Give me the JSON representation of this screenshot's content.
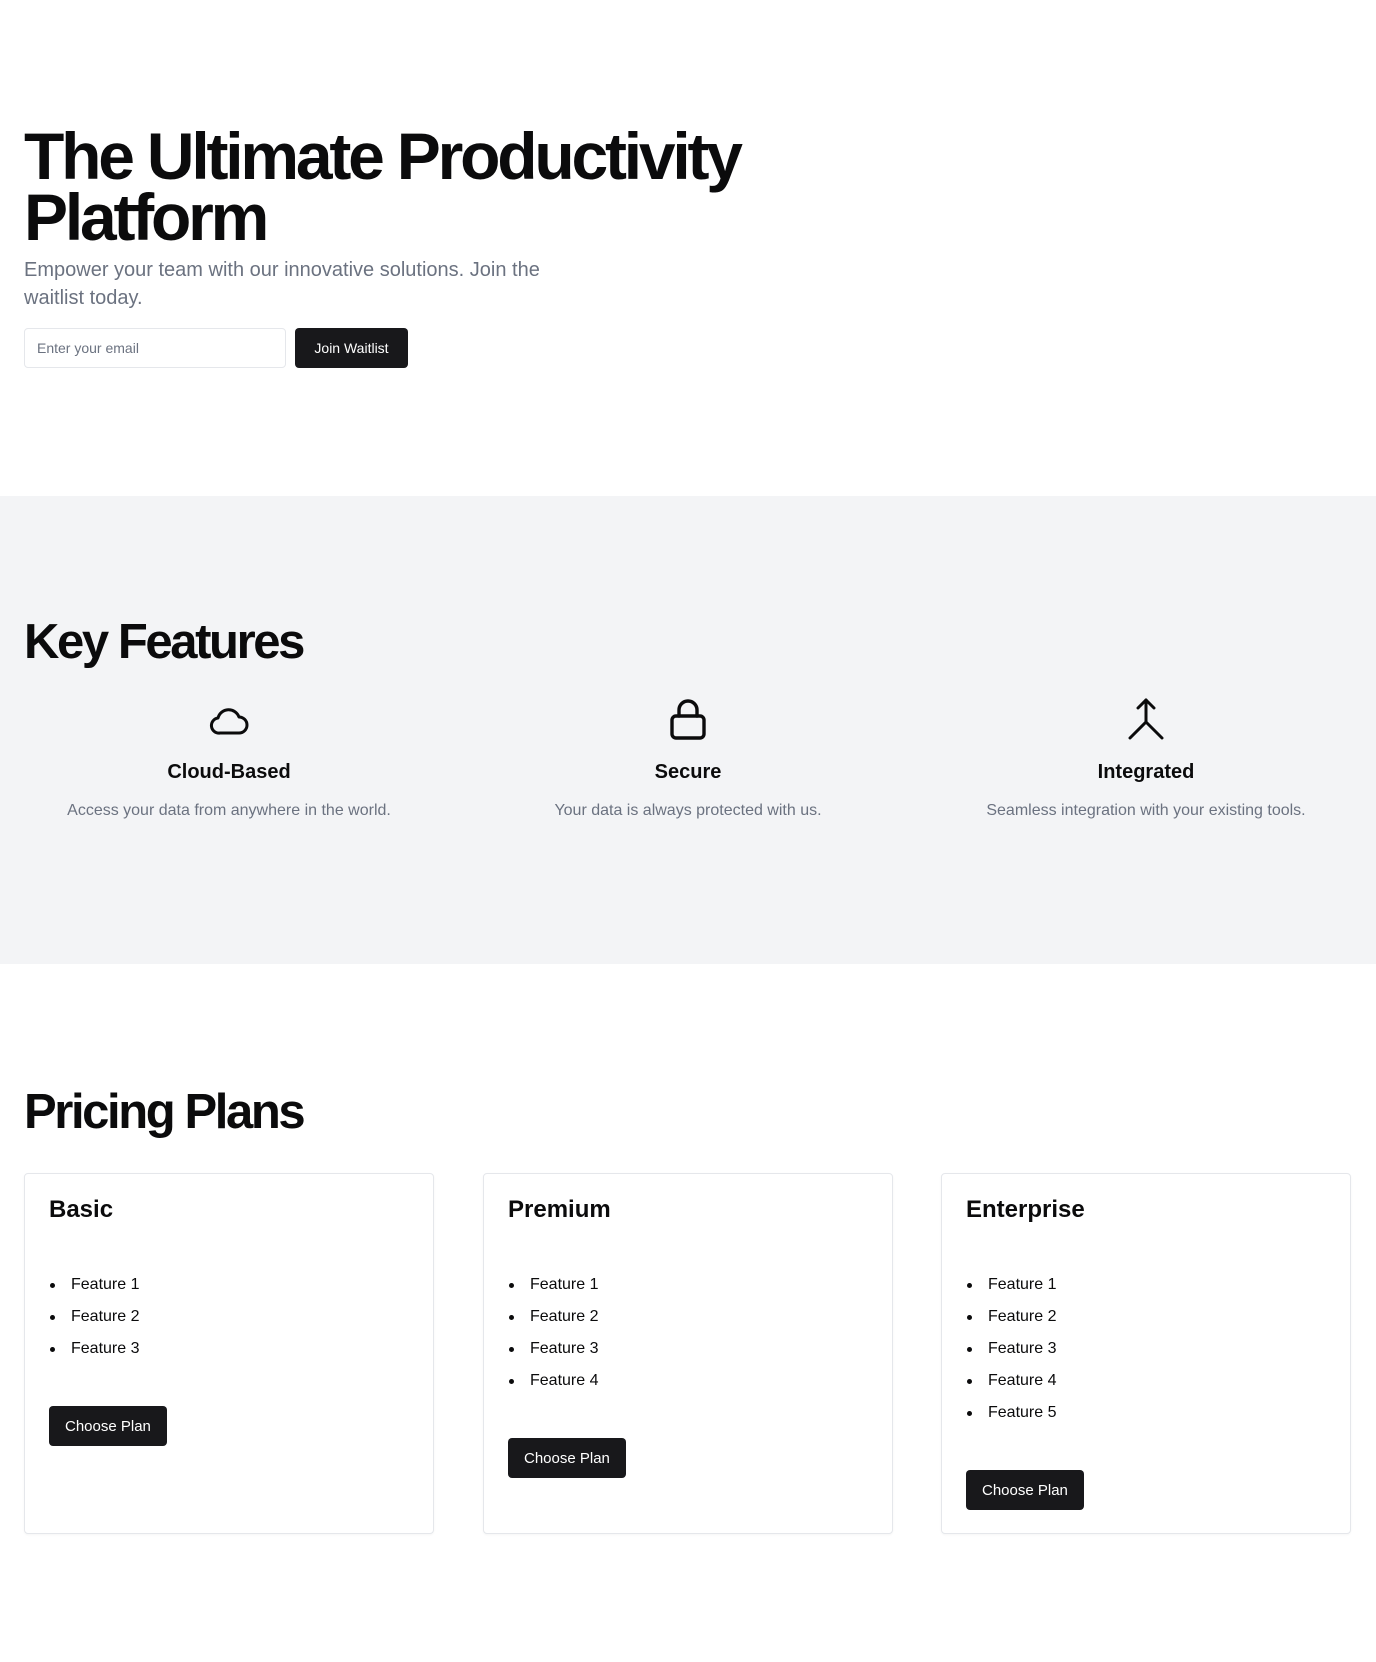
{
  "hero": {
    "title": "The Ultimate Productivity Platform",
    "subtitle": "Empower your team with our innovative solutions. Join the waitlist today.",
    "email_placeholder": "Enter your email",
    "email_value": "",
    "join_button": "Join Waitlist"
  },
  "features": {
    "title": "Key Features",
    "items": [
      {
        "icon": "cloud-icon",
        "title": "Cloud-Based",
        "description": "Access your data from anywhere in the world."
      },
      {
        "icon": "lock-icon",
        "title": "Secure",
        "description": "Your data is always protected with us."
      },
      {
        "icon": "merge-icon",
        "title": "Integrated",
        "description": "Seamless integration with your existing tools."
      }
    ]
  },
  "pricing": {
    "title": "Pricing Plans",
    "plans": [
      {
        "name": "Basic",
        "features": [
          "Feature 1",
          "Feature 2",
          "Feature 3"
        ],
        "button": "Choose Plan"
      },
      {
        "name": "Premium",
        "features": [
          "Feature 1",
          "Feature 2",
          "Feature 3",
          "Feature 4"
        ],
        "button": "Choose Plan"
      },
      {
        "name": "Enterprise",
        "features": [
          "Feature 1",
          "Feature 2",
          "Feature 3",
          "Feature 4",
          "Feature 5"
        ],
        "button": "Choose Plan"
      }
    ]
  },
  "colors": {
    "primary_button": "#18181b",
    "features_background": "#f3f4f6",
    "muted_text": "#6b7280"
  }
}
